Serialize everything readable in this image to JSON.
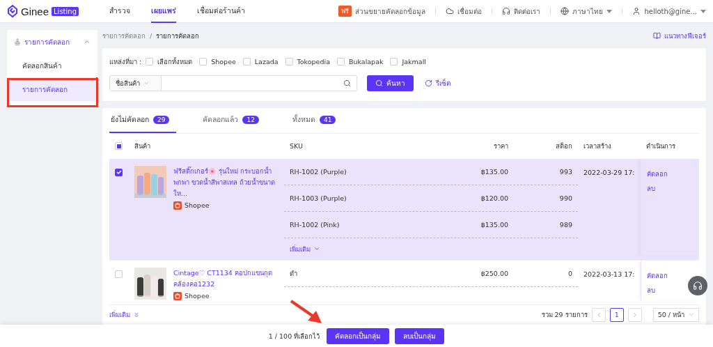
{
  "brand": {
    "name": "Ginee",
    "badge": "Listing"
  },
  "nav": [
    {
      "label": "สำรวจ",
      "selected": false
    },
    {
      "label": "เผยแพร่",
      "selected": true
    },
    {
      "label": "เชื่อมต่อร้านค้า",
      "selected": false
    }
  ],
  "header_actions": [
    {
      "kind": "promo",
      "badge": "ฟรี",
      "label": "ส่วนขยายคัดลอกข้อมูล"
    },
    {
      "kind": "connect",
      "label": "เชื่อมต่อ"
    },
    {
      "kind": "contact",
      "label": "ติดต่อเรา"
    },
    {
      "kind": "language",
      "label": "ภาษาไทย"
    },
    {
      "kind": "account",
      "label": "helloth@gine..."
    }
  ],
  "sidebar": {
    "group": {
      "label": "รายการคัดลอก",
      "expanded": true
    },
    "items": [
      {
        "label": "คัดลอกสินค้า",
        "selected": false
      },
      {
        "label": "รายการคัดลอก",
        "selected": true
      }
    ]
  },
  "breadcrumb": {
    "items": [
      "รายการคัดลอก",
      "รายการคัดลอก"
    ],
    "separator": "/"
  },
  "guide_link": "แนวทางฟีเจอร์",
  "filter": {
    "source_label": "แหล่งที่มา :",
    "sources": [
      {
        "label": "เลือกทั้งหมด",
        "checked": false
      },
      {
        "label": "Shopee",
        "checked": false
      },
      {
        "label": "Lazada",
        "checked": false
      },
      {
        "label": "Tokopedia",
        "checked": false
      },
      {
        "label": "Bukalapak",
        "checked": false
      },
      {
        "label": "Jakmall",
        "checked": false
      }
    ],
    "field_select": "ชื่อสินค้า",
    "search_button": "ค้นหา",
    "reset": "รีเซ็ต"
  },
  "tabs": [
    {
      "label": "ยังไม่คัดลอก",
      "count": "29",
      "selected": true
    },
    {
      "label": "คัดลอกแล้ว",
      "count": "12",
      "selected": false
    },
    {
      "label": "ทั้งหมด",
      "count": "41",
      "selected": false
    }
  ],
  "table": {
    "select_all": {
      "indeterminate": true
    },
    "columns": [
      "สินค้า",
      "SKU",
      "ราคา",
      "สต็อก",
      "เวลาสร้าง",
      "ดำเนินการ"
    ],
    "rows": [
      {
        "selected": true,
        "title": "ฟรีสติ๊กเกอร์🌸 รุ่นใหม่ กระบอกน้ำพกพา ขวดน้ำสีพาสเทล ถ้วยน้ำขนาดให...",
        "platform": "Shopee",
        "variants": [
          {
            "sku": "RH-1002 (Purple)",
            "price": "฿135.00",
            "stock": "993"
          },
          {
            "sku": "RH-1003 (Purple)",
            "price": "฿120.00",
            "stock": "990"
          },
          {
            "sku": "RH-1002 (Pink)",
            "price": "฿135.00",
            "stock": "989"
          }
        ],
        "more": "เพิ่มเติม",
        "created": "2022-03-29 17:",
        "actions": [
          "คัดลอก",
          "ลบ"
        ]
      },
      {
        "selected": false,
        "title": "Cintage♡ CT1134 คอปกแขนกุดคล้องคอ1232",
        "platform": "Shopee",
        "variants": [
          {
            "sku": "ดำ",
            "price": "฿250.00",
            "stock": "0"
          }
        ],
        "created": "2022-03-13 17:",
        "actions": [
          "คัดลอก",
          "ลบ"
        ]
      }
    ]
  },
  "table_footer": {
    "more": "เพิ่มเติม",
    "total": "รวม 29 รายการ",
    "pages": [
      {
        "label": "1",
        "selected": true
      }
    ],
    "page_size": "50 / หน้า"
  },
  "bottom_bar": {
    "selection": "1 / 100 ที่เลือกไว้",
    "buttons": [
      "คัดลอกเป็นกลุ่ม",
      "ลบเป็นกลุ่ม"
    ]
  }
}
